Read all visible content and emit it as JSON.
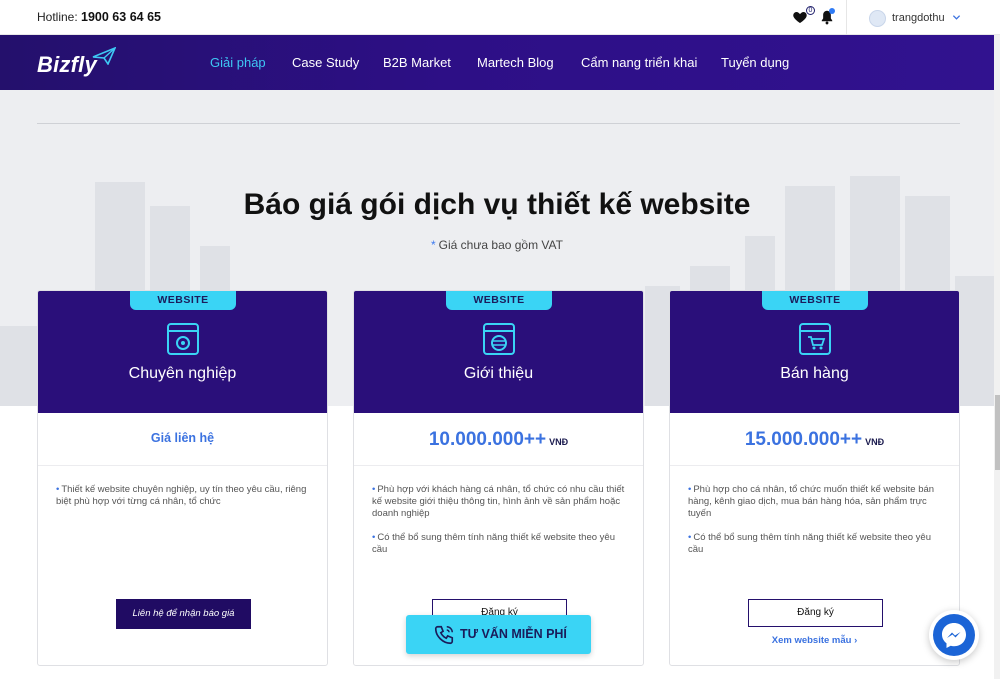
{
  "topbar": {
    "hotline_label": "Hotline:",
    "hotline_number": "1900 63 64 65",
    "wishlist_count": "0",
    "username": "trangdothu"
  },
  "nav": {
    "logo": "Bizfly",
    "items": [
      {
        "label": "Giải pháp",
        "active": true
      },
      {
        "label": "Case Study"
      },
      {
        "label": "B2B Market"
      },
      {
        "label": "Martech Blog"
      },
      {
        "label": "Cẩm nang triển khai"
      },
      {
        "label": "Tuyển dụng"
      }
    ]
  },
  "hero": {
    "title": "Báo giá gói dịch vụ thiết kế website",
    "note_star": "*",
    "note": "Giá chưa bao gồm VAT"
  },
  "cards": [
    {
      "tag": "WEBSITE",
      "icon": "settings-window-icon",
      "title": "Chuyên nghiệp",
      "price_contact": "Giá liên hệ",
      "bullets": [
        "Thiết kế website chuyên nghiệp, uy tín theo yêu cầu, riêng biệt phù hợp với từng cá nhân, tổ chức"
      ],
      "button": "Liên hệ để nhận báo giá"
    },
    {
      "tag": "WEBSITE",
      "icon": "intro-window-icon",
      "title": "Giới thiệu",
      "price": "10.000.000++",
      "unit": "VNĐ",
      "bullets": [
        "Phù hợp với khách hàng cá nhân, tổ chức có nhu cầu thiết kế website giới thiệu thông tin, hình ảnh về sản phẩm hoặc doanh nghiệp",
        "Có thể bổ sung thêm tính năng thiết kế website theo yêu cầu"
      ],
      "button": "Đăng ký"
    },
    {
      "tag": "WEBSITE",
      "icon": "cart-window-icon",
      "title": "Bán hàng",
      "price": "15.000.000++",
      "unit": "VNĐ",
      "bullets": [
        "Phù hợp cho cá nhân, tổ chức muốn thiết kế website bán hàng, kênh giao dịch, mua bán hàng hóa, sản phẩm trực tuyến",
        "Có thể bổ sung thêm tính năng thiết kế website theo yêu cầu"
      ],
      "button": "Đăng ký",
      "link": "Xem website mẫu ›"
    }
  ],
  "cta": {
    "label": "TƯ VẤN MIỄN PHÍ"
  },
  "colors": {
    "brand": "#2a0f7a",
    "accent": "#3ad4f5",
    "link": "#3b72e0"
  }
}
